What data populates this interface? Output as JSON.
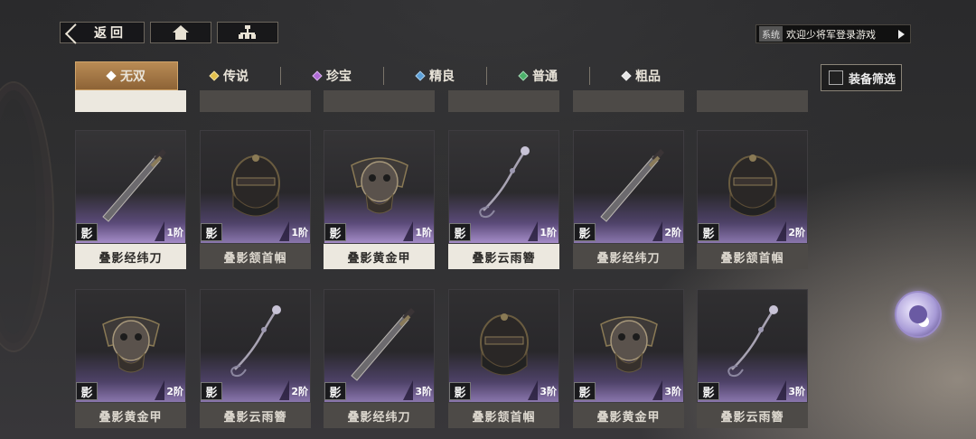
{
  "nav": {
    "back_label": "返回",
    "home_icon": "home-icon",
    "tree_icon": "hierarchy-icon"
  },
  "system": {
    "tag": "系统",
    "message": "欢迎少将军登录游戏"
  },
  "tabs": [
    {
      "label": "无双",
      "color": "#ffffff",
      "active": true
    },
    {
      "label": "传说",
      "color": "#e3c04a",
      "active": false
    },
    {
      "label": "珍宝",
      "color": "#b06bd6",
      "active": false
    },
    {
      "label": "精良",
      "color": "#5b9fd8",
      "active": false
    },
    {
      "label": "普通",
      "color": "#4bb06a",
      "active": false
    },
    {
      "label": "粗品",
      "color": "#e6e6e6",
      "active": false
    }
  ],
  "equip_filter": {
    "label": "装备筛选",
    "checked": false
  },
  "badge_char": "影",
  "rows": [
    [
      {
        "name": "叠影经纬刀",
        "tier": "1阶",
        "item": "blade",
        "name_style": "light"
      },
      {
        "name": "叠影颔首帼",
        "tier": "1阶",
        "item": "helmet",
        "name_style": "dark"
      },
      {
        "name": "叠影黄金甲",
        "tier": "1阶",
        "item": "armor",
        "name_style": "light"
      },
      {
        "name": "叠影云雨簪",
        "tier": "1阶",
        "item": "hairpin",
        "name_style": "light"
      },
      {
        "name": "叠影经纬刀",
        "tier": "2阶",
        "item": "blade",
        "name_style": "dark"
      },
      {
        "name": "叠影颔首帼",
        "tier": "2阶",
        "item": "helmet",
        "name_style": "dark"
      }
    ],
    [
      {
        "name": "叠影黄金甲",
        "tier": "2阶",
        "item": "armor",
        "name_style": "dark"
      },
      {
        "name": "叠影云雨簪",
        "tier": "2阶",
        "item": "hairpin",
        "name_style": "dark"
      },
      {
        "name": "叠影经纬刀",
        "tier": "3阶",
        "item": "blade",
        "name_style": "dark"
      },
      {
        "name": "叠影颔首帼",
        "tier": "3阶",
        "item": "helmet",
        "name_style": "dark"
      },
      {
        "name": "叠影黄金甲",
        "tier": "3阶",
        "item": "armor",
        "name_style": "dark"
      },
      {
        "name": "叠影云雨簪",
        "tier": "3阶",
        "item": "hairpin",
        "name_style": "dark"
      }
    ]
  ],
  "partial_row_styles": [
    "light",
    "dark",
    "dark",
    "dark",
    "dark",
    "dark"
  ],
  "avatar_icon": "character-avatar-icon"
}
